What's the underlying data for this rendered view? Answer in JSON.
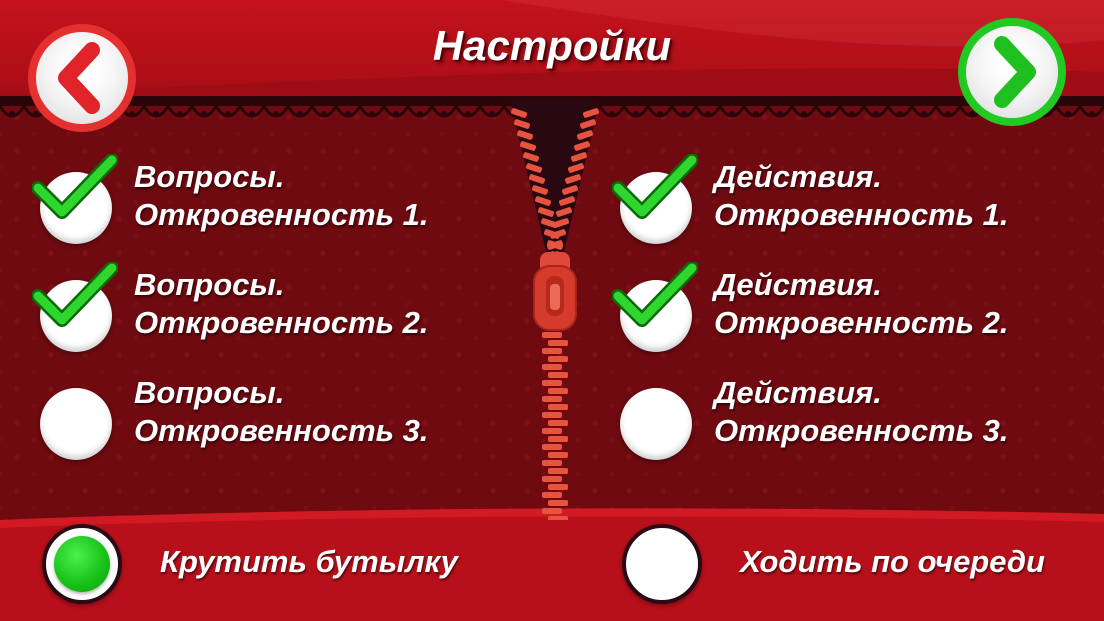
{
  "header": {
    "title": "Настройки"
  },
  "nav": {
    "back_icon": "chevron-left-icon",
    "next_icon": "chevron-right-icon"
  },
  "questions": [
    {
      "line1": "Вопросы.",
      "line2": "Откровенность 1.",
      "checked": true
    },
    {
      "line1": "Вопросы.",
      "line2": "Откровенность 2.",
      "checked": true
    },
    {
      "line1": "Вопросы.",
      "line2": "Откровенность 3.",
      "checked": false
    }
  ],
  "actions": [
    {
      "line1": "Действия.",
      "line2": "Откровенность 1.",
      "checked": true
    },
    {
      "line1": "Действия.",
      "line2": "Откровенность 2.",
      "checked": true
    },
    {
      "line1": "Действия.",
      "line2": "Откровенность 3.",
      "checked": false
    }
  ],
  "modes": {
    "spin_bottle": {
      "label": "Крутить бутылку",
      "selected": true
    },
    "take_turns": {
      "label": "Ходить по очереди",
      "selected": false
    }
  },
  "colors": {
    "primary_red": "#c4121c",
    "dark_red": "#6e0a10",
    "accent_green": "#19c419",
    "text": "#ffffff"
  }
}
